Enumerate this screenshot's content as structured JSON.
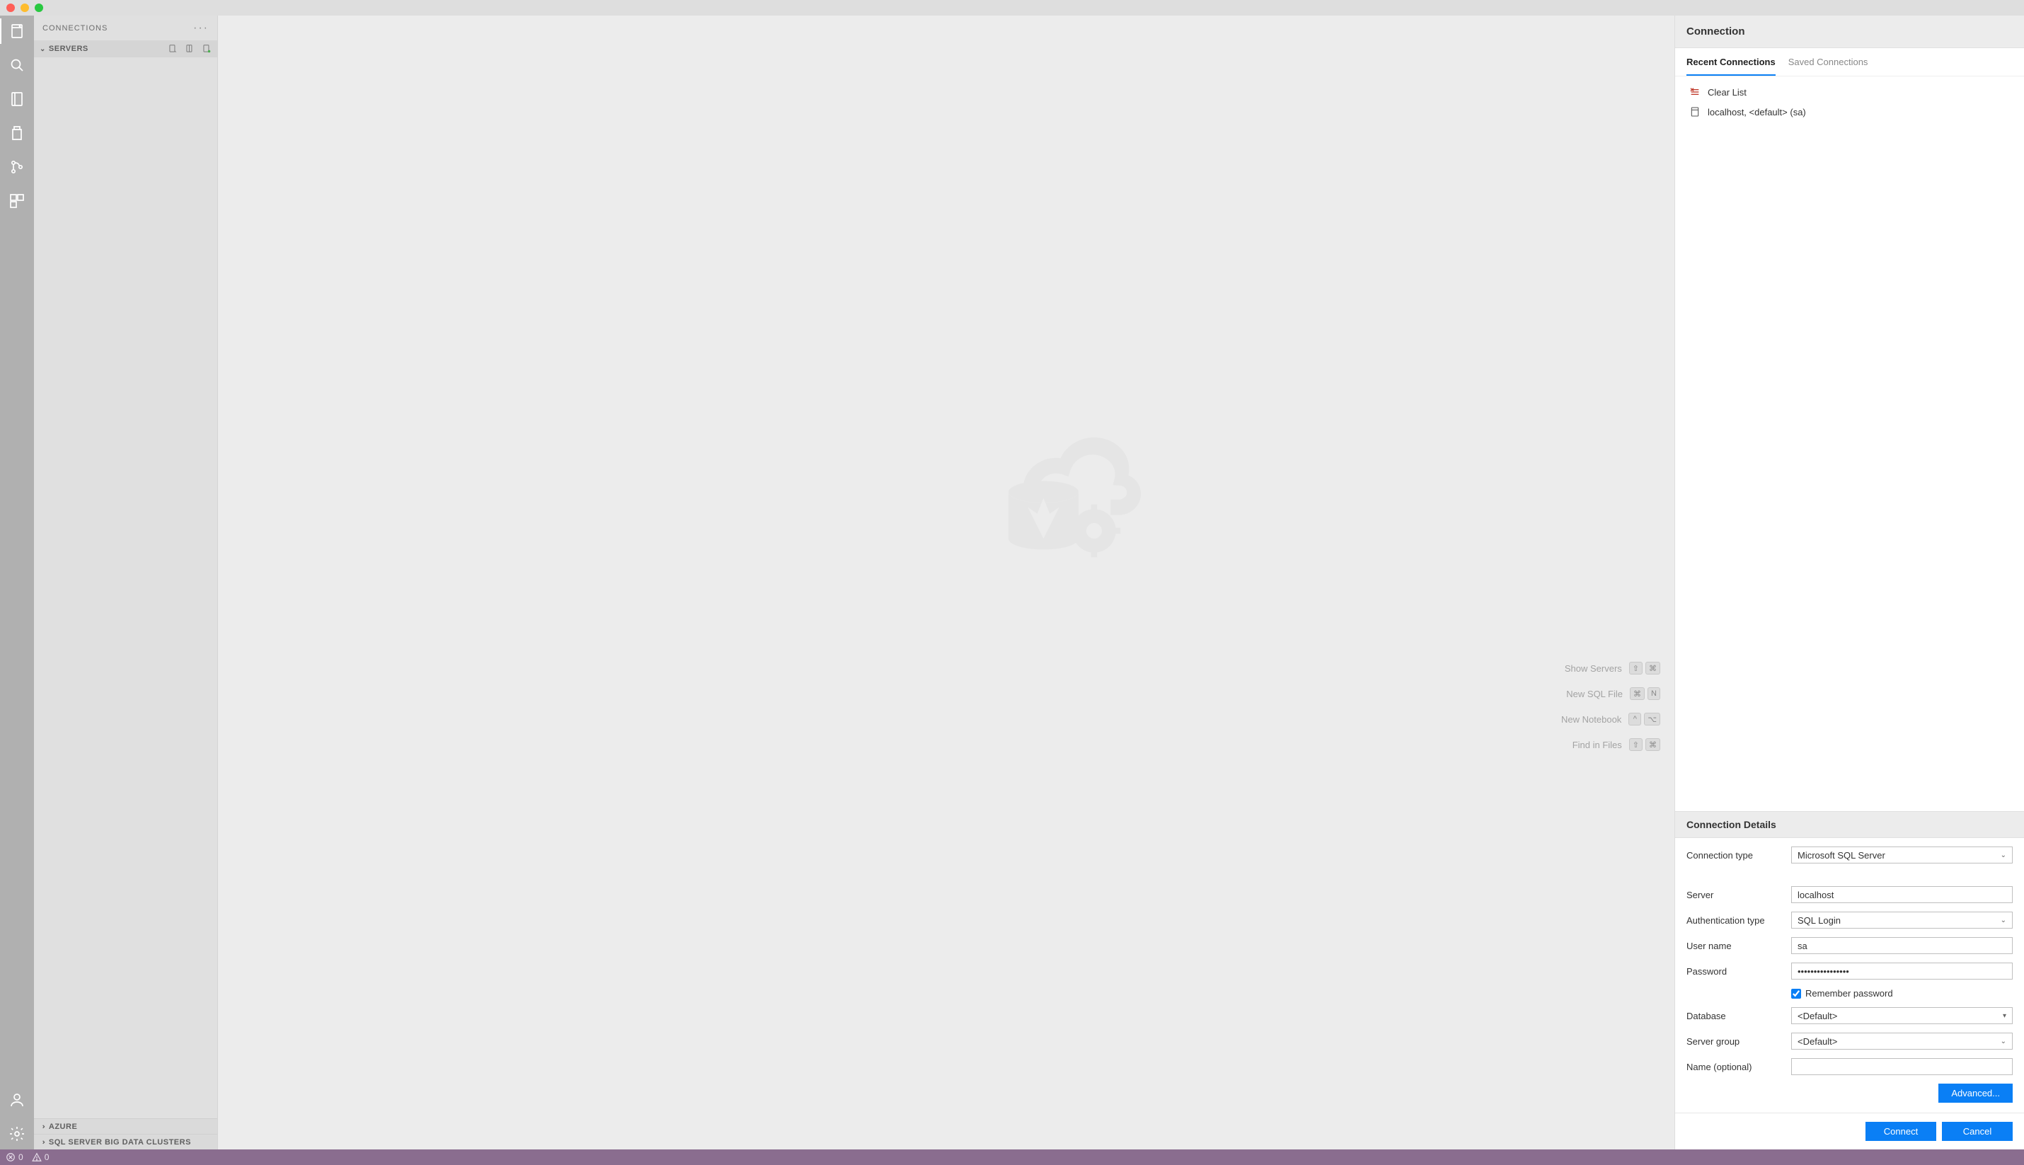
{
  "sidepanel": {
    "title": "CONNECTIONS",
    "sections": {
      "servers": "SERVERS",
      "azure": "AZURE",
      "bigdata": "SQL SERVER BIG DATA CLUSTERS"
    }
  },
  "shortcuts": {
    "show_servers": "Show Servers",
    "new_sql": "New SQL File",
    "new_notebook": "New Notebook",
    "find_files": "Find in Files",
    "keys": {
      "show_servers": [
        "⇧",
        "⌘"
      ],
      "new_sql": [
        "⌘",
        "N"
      ],
      "new_notebook": [
        "^",
        "⌥"
      ],
      "find_files": [
        "⇧",
        "⌘"
      ]
    }
  },
  "conn": {
    "header": "Connection",
    "tabs": {
      "recent": "Recent Connections",
      "saved": "Saved Connections"
    },
    "recent": {
      "clear": "Clear List",
      "item1": "localhost, <default> (sa)"
    },
    "details_header": "Connection Details",
    "labels": {
      "type": "Connection type",
      "server": "Server",
      "auth": "Authentication type",
      "user": "User name",
      "password": "Password",
      "remember": "Remember password",
      "database": "Database",
      "group": "Server group",
      "name": "Name (optional)"
    },
    "values": {
      "type": "Microsoft SQL Server",
      "server": "localhost",
      "auth": "SQL Login",
      "user": "sa",
      "password": "••••••••••••••••",
      "database": "<Default>",
      "group": "<Default>",
      "name": ""
    },
    "buttons": {
      "advanced": "Advanced...",
      "connect": "Connect",
      "cancel": "Cancel"
    }
  },
  "status": {
    "errors": "0",
    "warnings": "0"
  }
}
